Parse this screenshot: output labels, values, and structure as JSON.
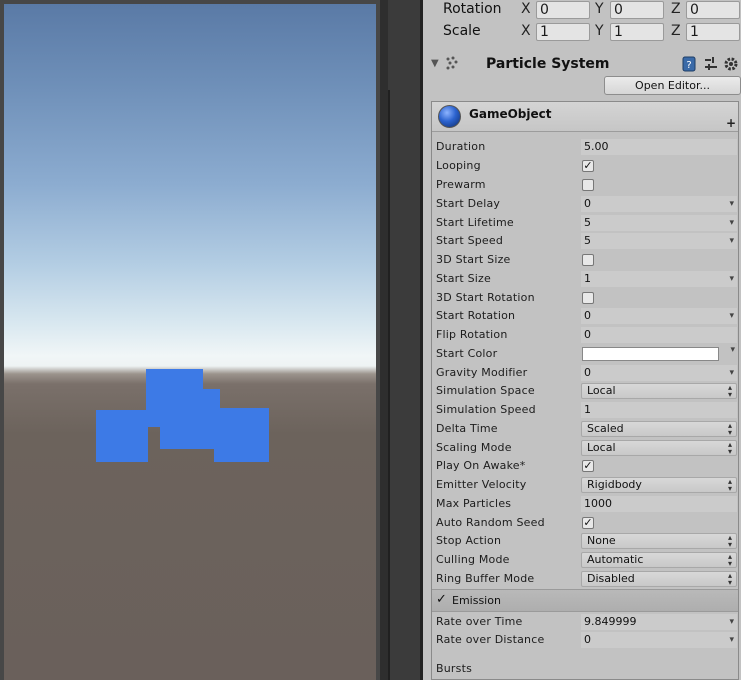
{
  "transform": {
    "rotation": {
      "label": "Rotation",
      "x_axis": "X",
      "x": "0",
      "y_axis": "Y",
      "y": "0",
      "z_axis": "Z",
      "z": "0"
    },
    "scale": {
      "label": "Scale",
      "x_axis": "X",
      "x": "1",
      "y_axis": "Y",
      "y": "1",
      "z_axis": "Z",
      "z": "1"
    }
  },
  "component": {
    "title": "Particle System",
    "open_editor_label": "Open Editor...",
    "object_name": "GameObject"
  },
  "main_module": {
    "duration": {
      "label": "Duration",
      "value": "5.00"
    },
    "looping": {
      "label": "Looping",
      "checked": "✓"
    },
    "prewarm": {
      "label": "Prewarm"
    },
    "start_delay": {
      "label": "Start Delay",
      "value": "0"
    },
    "start_lifetime": {
      "label": "Start Lifetime",
      "value": "5"
    },
    "start_speed": {
      "label": "Start Speed",
      "value": "5"
    },
    "start_size_3d": {
      "label": "3D Start Size"
    },
    "start_size": {
      "label": "Start Size",
      "value": "1"
    },
    "start_rotation_3d": {
      "label": "3D Start Rotation"
    },
    "start_rotation": {
      "label": "Start Rotation",
      "value": "0"
    },
    "flip_rotation": {
      "label": "Flip Rotation",
      "value": "0"
    },
    "start_color": {
      "label": "Start Color",
      "color": "#ffffff"
    },
    "gravity_modifier": {
      "label": "Gravity Modifier",
      "value": "0"
    },
    "simulation_space": {
      "label": "Simulation Space",
      "value": "Local"
    },
    "simulation_speed": {
      "label": "Simulation Speed",
      "value": "1"
    },
    "delta_time": {
      "label": "Delta Time",
      "value": "Scaled"
    },
    "scaling_mode": {
      "label": "Scaling Mode",
      "value": "Local"
    },
    "play_on_awake": {
      "label": "Play On Awake*",
      "checked": "✓"
    },
    "emitter_velocity": {
      "label": "Emitter Velocity",
      "value": "Rigidbody"
    },
    "max_particles": {
      "label": "Max Particles",
      "value": "1000"
    },
    "auto_random_seed": {
      "label": "Auto Random Seed",
      "checked": "✓"
    },
    "stop_action": {
      "label": "Stop Action",
      "value": "None"
    },
    "culling_mode": {
      "label": "Culling Mode",
      "value": "Automatic"
    },
    "ring_buffer_mode": {
      "label": "Ring Buffer Mode",
      "value": "Disabled"
    }
  },
  "emission": {
    "title": "Emission",
    "checked": "✓",
    "rate_over_time": {
      "label": "Rate over Time",
      "value": "9.849999"
    },
    "rate_over_distance": {
      "label": "Rate over Distance",
      "value": "0"
    },
    "bursts": {
      "label": "Bursts"
    }
  },
  "colors": {
    "cube_blue": "#3d7ae6",
    "inspector_bg": "#c2c2c2"
  }
}
